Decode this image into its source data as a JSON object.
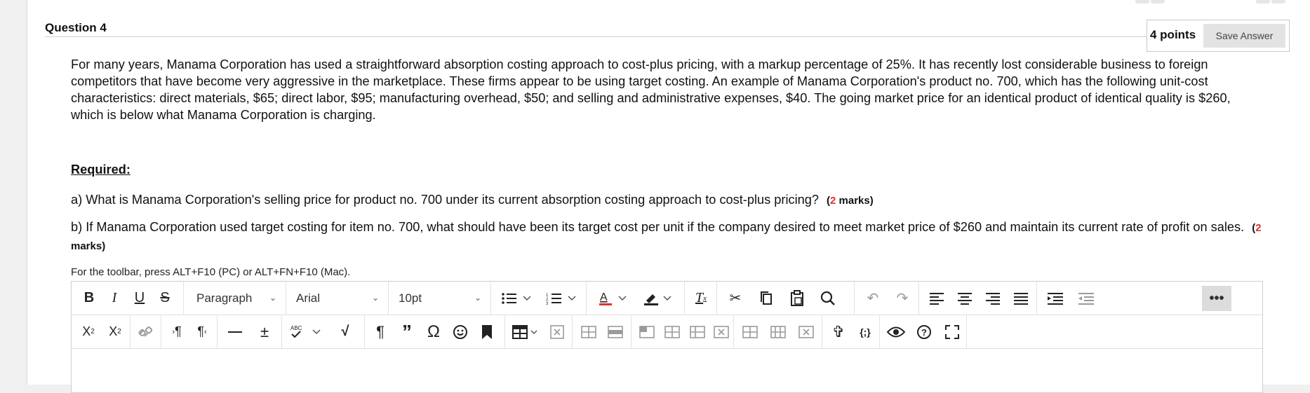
{
  "question": {
    "title": "Question 4",
    "points": "4 points",
    "save_label": "Save Answer",
    "intro": "For many years, Manama Corporation has used a straightforward absorption costing approach to cost-plus pricing, with a markup percentage of 25%. It has recently lost considerable business to foreign competitors that have become very aggressive in the marketplace. These firms appear to be using target costing. An example of Manama Corporation's product no. 700, which has the following unit-cost characteristics: direct materials, $65; direct labor, $95; manufacturing overhead, $50; and selling and administrative expenses, $40. The going market price for an identical product of identical quality is $260, which is below what Manama Corporation is charging.",
    "required_heading": "Required:",
    "part_a": "a) What is Manama Corporation's selling price for product no. 700 under its current absorption costing approach to cost-plus pricing?",
    "part_a_marks_open": "(",
    "part_a_marks_num": "2",
    "part_a_marks_close": " marks)",
    "part_b": " b) If Manama Corporation used target costing for item no. 700, what should have been its target cost per unit if the company desired to meet market price of $260 and maintain its current rate of profit on sales.",
    "part_b_marks_open": "(",
    "part_b_marks_num": "2",
    "part_b_marks_close": " marks)"
  },
  "editor": {
    "toolbar_hint": "For the toolbar, press ALT+F10 (PC) or ALT+FN+F10 (Mac).",
    "block_format": "Paragraph",
    "font_family": "Arial",
    "font_size": "10pt",
    "accent_color": "#e03131",
    "icons_row1": [
      "bold-icon",
      "italic-icon",
      "underline-icon",
      "strikethrough-icon",
      "bullet-list-icon",
      "numbered-list-icon",
      "text-color-icon",
      "highlight-icon",
      "clear-format-icon",
      "cut-icon",
      "copy-icon",
      "paste-icon",
      "find-icon",
      "undo-icon",
      "redo-icon",
      "align-left-icon",
      "align-center-icon",
      "align-right-icon",
      "justify-icon",
      "indent-icon",
      "outdent-icon",
      "more-icon"
    ],
    "icons_row2": [
      "superscript-icon",
      "subscript-icon",
      "unlink-icon",
      "ltr-icon",
      "rtl-icon",
      "horizontal-rule-icon",
      "plus-minus-icon",
      "spellcheck-icon",
      "math-icon",
      "pilcrow-icon",
      "blockquote-icon",
      "omega-icon",
      "emoji-icon",
      "bookmark-icon",
      "table-icon",
      "delete-table-icon",
      "insert-row-icon",
      "delete-row-icon",
      "cell-props-icon",
      "insert-col-before-icon",
      "insert-col-after-icon",
      "delete-col-icon",
      "merge-cells-icon",
      "split-cells-icon",
      "delete-cell-icon",
      "accessibility-icon",
      "code-icon",
      "preview-icon",
      "help-icon",
      "fullscreen-icon"
    ]
  }
}
